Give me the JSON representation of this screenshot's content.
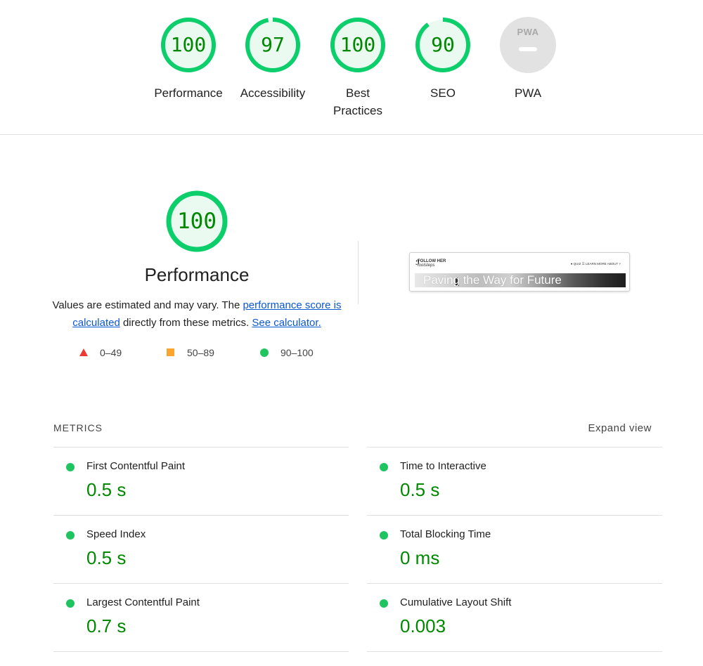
{
  "categories": [
    {
      "label": "Performance",
      "score": "100",
      "fraction": 1.0
    },
    {
      "label": "Accessibility",
      "score": "97",
      "fraction": 0.97
    },
    {
      "label": "Best\nPractices",
      "score": "100",
      "fraction": 1.0
    },
    {
      "label": "SEO",
      "score": "90",
      "fraction": 0.9
    },
    {
      "label": "PWA",
      "badge_text": "PWA"
    }
  ],
  "performance": {
    "score": "100",
    "fraction": 1.0,
    "title": "Performance",
    "desc_pre": "Values are estimated and may vary. The ",
    "link_score": "performance score is calculated",
    "desc_mid": " directly from these metrics. ",
    "link_calc": "See calculator."
  },
  "legend": {
    "fail": "0–49",
    "average": "50–89",
    "pass": "90–100"
  },
  "thumbnail": {
    "logo_line1": "FOLLOW HER",
    "logo_line2": "footsteps",
    "nav": "● QUIZ   ☰ LEARN MORE ABOUT ˅",
    "hero_text": "Paving the Way for Future"
  },
  "metrics": {
    "title": "METRICS",
    "expand_label": "Expand view",
    "items": [
      {
        "name": "First Contentful Paint",
        "value": "0.5 s"
      },
      {
        "name": "Time to Interactive",
        "value": "0.5 s"
      },
      {
        "name": "Speed Index",
        "value": "0.5 s"
      },
      {
        "name": "Total Blocking Time",
        "value": "0 ms"
      },
      {
        "name": "Largest Contentful Paint",
        "value": "0.7 s"
      },
      {
        "name": "Cumulative Layout Shift",
        "value": "0.003"
      }
    ]
  },
  "colors": {
    "pass": "#0cce6b",
    "pass_text": "#008800",
    "pass_bg": "#eafaf0",
    "average": "#fba42e",
    "fail": "#eb3a2f",
    "pwa": "#e2e2e2",
    "link": "#0b57d0"
  }
}
